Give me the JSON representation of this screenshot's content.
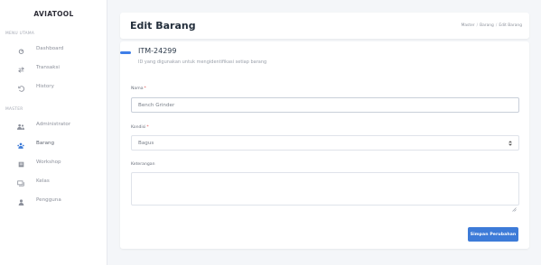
{
  "sidebar": {
    "brand": "AVIATOOL",
    "section_main": "MENU UTAMA",
    "section_master": "MASTER",
    "main_items": [
      {
        "label": "Dashboard",
        "icon": "dashboard-icon"
      },
      {
        "label": "Transaksi",
        "icon": "transfer-icon"
      },
      {
        "label": "History",
        "icon": "history-icon"
      }
    ],
    "master_items": [
      {
        "label": "Administrator",
        "icon": "admin-icon"
      },
      {
        "label": "Barang",
        "icon": "users-icon"
      },
      {
        "label": "Workshop",
        "icon": "workshop-icon"
      },
      {
        "label": "Kelas",
        "icon": "class-icon"
      },
      {
        "label": "Pengguna",
        "icon": "user-icon"
      }
    ]
  },
  "header": {
    "title": "Edit Barang",
    "breadcrumb": [
      "Master",
      "Barang",
      "Edit Barang"
    ]
  },
  "item": {
    "code": "ITM-24299",
    "description": "ID yang digunakan untuk mengidentifikasi setiap barang"
  },
  "form": {
    "name_label": "Nama",
    "name_value": "Bench Grinder",
    "condition_label": "Kondisi",
    "condition_value": "Bagus",
    "notes_label": "Keterangan",
    "notes_value": "",
    "required_mark": "*",
    "save_label": "Simpan Perubahan"
  },
  "colors": {
    "accent": "#3d7bd8",
    "sidebar_bg": "#ffffff",
    "page_bg": "#f4f6f9"
  }
}
